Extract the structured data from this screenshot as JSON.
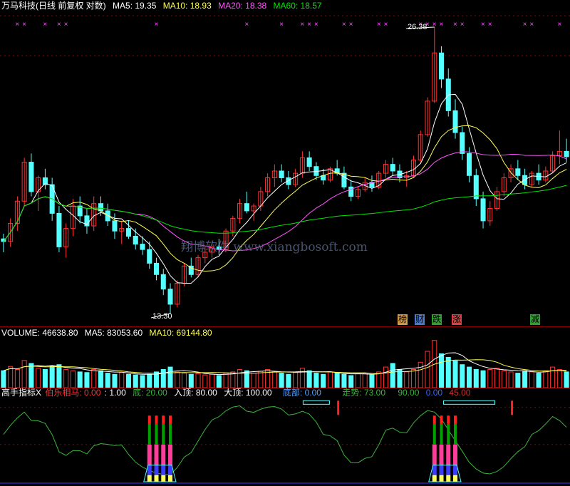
{
  "price_header": {
    "title": "万马科技(日线 前复权 对数)",
    "ma5_label": "MA5: 19.35",
    "ma10_label": "MA10: 18.93",
    "ma20_label": "MA20: 18.38",
    "ma60_label": "MA60: 18.57"
  },
  "price_annotations": {
    "high_label": "26.38",
    "low_label": "13.30"
  },
  "watermark": "翔博软件 www.xiangbosoft.com",
  "event_tags": [
    {
      "text": "榜",
      "color": "#d29a4a"
    },
    {
      "text": "财",
      "color": "#4a7ad0"
    },
    {
      "text": "跌",
      "color": "#30a030"
    },
    {
      "text": "涨",
      "color": "#e04040"
    },
    {
      "text": "减",
      "color": "#30a030"
    }
  ],
  "volume_header": {
    "volume_label": "VOLUME: 46638.80",
    "ma5_label": "MA5: 83053.60",
    "ma10_label": "MA10: 69144.80"
  },
  "indicator_header": {
    "name": "高手指标X",
    "bole_label": "伯乐相马: 0.00",
    "one_label": ": 1.00",
    "bottom_label": "底: 20.00",
    "entry_label": "入顶: 80.00",
    "top_label": "大顶: 100.00",
    "base_label": "底部: 0.00",
    "trend_label": "走势: 73.00",
    "v90_label": "90.00",
    "v0_label": "0.00",
    "v45_label": "45.00"
  },
  "colors": {
    "up": "#ff3232",
    "down": "#54ffff",
    "ma5": "#ffffff",
    "ma10": "#ffff54",
    "ma20": "#ff54ff",
    "ma60": "#00e600",
    "divider": "#8b0000",
    "trend": "#3cb43c"
  },
  "chart_data": {
    "type": "candlestick",
    "scale": "log",
    "ylim": [
      13.3,
      26.38
    ],
    "volume_ylim": [
      0,
      80
    ],
    "indicator_ylim": [
      0,
      100
    ],
    "candles": [
      [
        15.9,
        16.1,
        15.4,
        15.8
      ],
      [
        15.8,
        16.7,
        15.6,
        16.5
      ],
      [
        16.5,
        17.6,
        16.2,
        17.4
      ],
      [
        17.4,
        19.3,
        17.2,
        19.1
      ],
      [
        19.1,
        19.5,
        17.6,
        17.8
      ],
      [
        17.8,
        18.5,
        17.0,
        18.4
      ],
      [
        18.4,
        18.8,
        17.9,
        18.1
      ],
      [
        18.1,
        18.4,
        16.6,
        16.9
      ],
      [
        16.9,
        17.2,
        15.4,
        15.6
      ],
      [
        15.6,
        16.5,
        15.2,
        16.3
      ],
      [
        16.3,
        17.5,
        16.0,
        17.2
      ],
      [
        17.2,
        17.6,
        16.5,
        16.8
      ],
      [
        16.8,
        17.1,
        16.1,
        16.4
      ],
      [
        16.4,
        17.6,
        16.2,
        17.3
      ],
      [
        17.3,
        17.6,
        16.8,
        17.0
      ],
      [
        17.0,
        17.3,
        16.4,
        16.6
      ],
      [
        16.6,
        16.9,
        15.9,
        16.2
      ],
      [
        16.2,
        16.6,
        15.7,
        16.3
      ],
      [
        16.3,
        16.6,
        15.9,
        16.0
      ],
      [
        16.0,
        16.3,
        15.5,
        15.7
      ],
      [
        15.7,
        16.0,
        15.3,
        15.5
      ],
      [
        15.5,
        15.8,
        14.8,
        15.0
      ],
      [
        15.0,
        15.2,
        14.4,
        14.6
      ],
      [
        14.6,
        14.8,
        13.9,
        14.1
      ],
      [
        14.1,
        14.3,
        13.3,
        13.6
      ],
      [
        13.6,
        14.4,
        13.5,
        14.3
      ],
      [
        14.3,
        15.0,
        14.2,
        14.9
      ],
      [
        14.9,
        15.2,
        14.5,
        14.6
      ],
      [
        14.6,
        15.3,
        14.5,
        15.2
      ],
      [
        15.2,
        15.6,
        15.0,
        15.4
      ],
      [
        15.4,
        15.8,
        15.2,
        15.6
      ],
      [
        15.6,
        15.9,
        15.3,
        15.5
      ],
      [
        15.5,
        16.3,
        15.4,
        16.2
      ],
      [
        16.2,
        16.8,
        16.0,
        16.7
      ],
      [
        16.7,
        17.5,
        16.5,
        17.3
      ],
      [
        17.3,
        17.8,
        16.9,
        17.0
      ],
      [
        17.0,
        17.3,
        16.6,
        17.2
      ],
      [
        17.2,
        18.0,
        17.0,
        17.8
      ],
      [
        17.8,
        18.6,
        17.6,
        18.4
      ],
      [
        18.4,
        19.0,
        18.0,
        18.7
      ],
      [
        18.7,
        19.0,
        18.2,
        18.4
      ],
      [
        18.4,
        18.7,
        17.9,
        18.1
      ],
      [
        18.1,
        18.8,
        18.0,
        18.6
      ],
      [
        18.6,
        19.6,
        18.4,
        19.3
      ],
      [
        19.3,
        19.6,
        18.7,
        18.9
      ],
      [
        18.9,
        19.1,
        18.3,
        18.5
      ],
      [
        18.5,
        18.8,
        18.1,
        18.3
      ],
      [
        18.3,
        18.9,
        18.2,
        18.8
      ],
      [
        18.8,
        19.2,
        18.5,
        18.6
      ],
      [
        18.6,
        18.9,
        17.9,
        18.0
      ],
      [
        18.0,
        18.3,
        17.4,
        17.6
      ],
      [
        17.6,
        18.0,
        17.5,
        17.9
      ],
      [
        17.9,
        18.4,
        17.8,
        18.2
      ],
      [
        18.2,
        18.5,
        17.8,
        18.0
      ],
      [
        18.0,
        18.7,
        17.9,
        18.6
      ],
      [
        18.6,
        19.2,
        18.4,
        19.0
      ],
      [
        19.0,
        19.3,
        18.5,
        18.7
      ],
      [
        18.7,
        19.0,
        18.2,
        18.4
      ],
      [
        18.4,
        18.7,
        18.0,
        18.5
      ],
      [
        18.5,
        19.4,
        18.4,
        19.2
      ],
      [
        19.2,
        20.6,
        19.1,
        20.4
      ],
      [
        20.4,
        22.3,
        20.3,
        22.1
      ],
      [
        22.1,
        26.38,
        22.0,
        24.8
      ],
      [
        24.8,
        25.2,
        22.8,
        23.3
      ],
      [
        23.3,
        23.9,
        21.3,
        21.6
      ],
      [
        21.6,
        22.2,
        20.2,
        20.5
      ],
      [
        20.5,
        20.8,
        19.2,
        19.5
      ],
      [
        19.5,
        19.8,
        18.2,
        18.5
      ],
      [
        18.5,
        18.8,
        17.2,
        17.5
      ],
      [
        17.5,
        17.8,
        16.3,
        16.6
      ],
      [
        16.6,
        17.4,
        16.4,
        17.1
      ],
      [
        17.1,
        18.0,
        17.0,
        17.8
      ],
      [
        17.8,
        18.6,
        17.6,
        18.4
      ],
      [
        18.4,
        19.0,
        18.2,
        18.8
      ],
      [
        18.8,
        19.2,
        18.3,
        18.5
      ],
      [
        18.5,
        18.8,
        17.9,
        18.1
      ],
      [
        18.1,
        18.7,
        18.0,
        18.6
      ],
      [
        18.6,
        19.0,
        18.1,
        18.3
      ],
      [
        18.3,
        18.9,
        18.2,
        18.7
      ],
      [
        18.7,
        19.6,
        18.6,
        19.4
      ],
      [
        19.4,
        20.6,
        19.0,
        19.6
      ],
      [
        19.6,
        20.2,
        19.1,
        19.35
      ]
    ],
    "volume": [
      28,
      35,
      30,
      45,
      40,
      32,
      30,
      36,
      38,
      30,
      28,
      26,
      25,
      30,
      28,
      24,
      22,
      25,
      22,
      21,
      20,
      22,
      26,
      30,
      34,
      26,
      24,
      22,
      23,
      21,
      22,
      20,
      24,
      26,
      30,
      28,
      24,
      27,
      30,
      26,
      24,
      22,
      25,
      32,
      28,
      24,
      22,
      26,
      24,
      22,
      20,
      23,
      24,
      21,
      26,
      34,
      40,
      30,
      26,
      30,
      42,
      60,
      78,
      56,
      50,
      44,
      38,
      34,
      30,
      28,
      30,
      32,
      28,
      26,
      24,
      28,
      26,
      24,
      28,
      34,
      30,
      26
    ]
  }
}
